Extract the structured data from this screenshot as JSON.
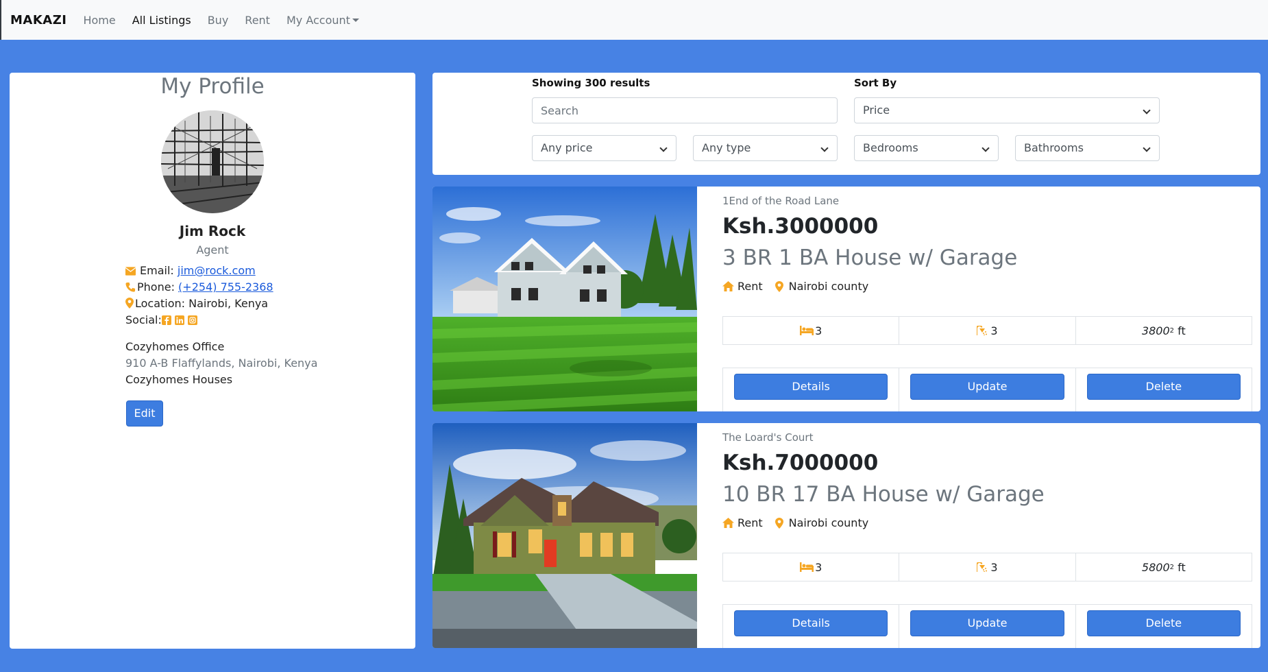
{
  "nav": {
    "brand": "MAKAZI",
    "links": [
      {
        "label": "Home"
      },
      {
        "label": "All Listings"
      },
      {
        "label": "Buy"
      },
      {
        "label": "Rent"
      },
      {
        "label": "My Account"
      }
    ]
  },
  "profile": {
    "title": "My Profile",
    "name": "Jim Rock",
    "role": "Agent",
    "email_label": "Email:",
    "email": "jim@rock.com",
    "phone_label": "Phone:",
    "phone": "(+254) 755-2368",
    "location": "Location: Nairobi, Kenya",
    "social_label": "Social:",
    "office_name": "Cozyhomes Office",
    "office_address": "910 A-B Flaffylands, Nairobi, Kenya",
    "office_brand": "Cozyhomes Houses",
    "edit_label": "Edit"
  },
  "filters": {
    "results_label": "Showing 300 results",
    "search_placeholder": "Search",
    "sort_label": "Sort By",
    "sort_value": "Price",
    "price": "Any price",
    "type": "Any type",
    "bedrooms": "Bedrooms",
    "bathrooms": "Bathrooms"
  },
  "listings": [
    {
      "address": "1End of the Road Lane",
      "price": "Ksh.3000000",
      "title": "3 BR 1 BA House w/ Garage",
      "status": "Rent",
      "county": "Nairobi county",
      "beds": "3",
      "baths": "3",
      "area": "3800",
      "unit": " ft",
      "details": "Details",
      "update": "Update",
      "delete": "Delete"
    },
    {
      "address": "The Loard's Court",
      "price": "Ksh.7000000",
      "title": "10 BR 17 BA House w/ Garage",
      "status": "Rent",
      "county": "Nairobi county",
      "beds": "3",
      "baths": "3",
      "area": "5800",
      "unit": " ft",
      "details": "Details",
      "update": "Update",
      "delete": "Delete"
    }
  ],
  "colors": {
    "page_bg": "#4782e4",
    "button": "#3d7de0",
    "icon": "#f5a623"
  }
}
